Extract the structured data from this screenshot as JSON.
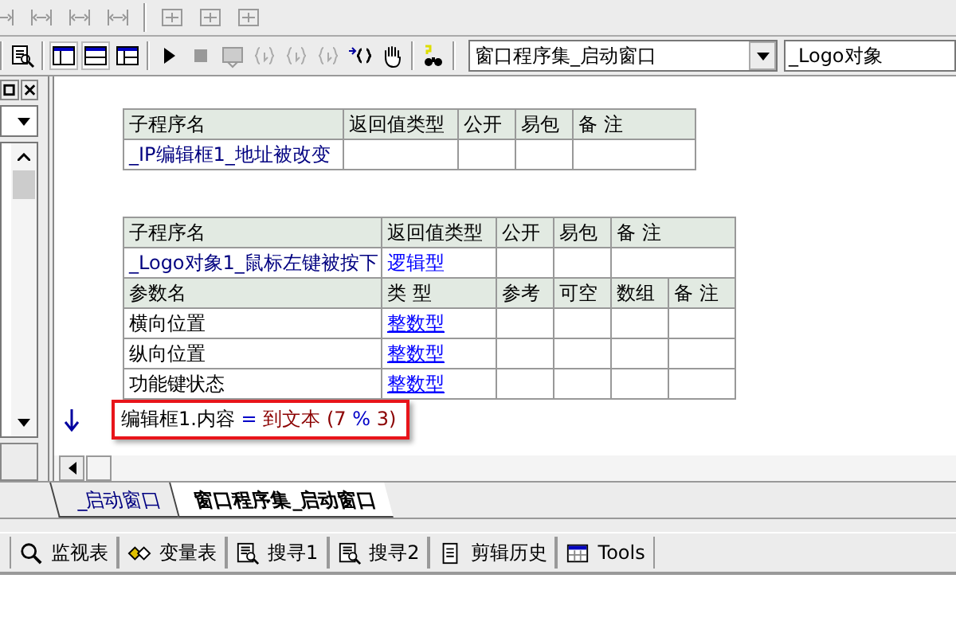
{
  "toolbar": {
    "module_select": {
      "value": "窗口程序集_启动窗口"
    },
    "object_select": {
      "value": "_Logo对象"
    }
  },
  "tables": [
    {
      "columns": [
        "子程序名",
        "返回值类型",
        "公开",
        "易包",
        "备 注"
      ],
      "row": {
        "name": "_IP编辑框1_地址被改变"
      }
    },
    {
      "columns": [
        "子程序名",
        "返回值类型",
        "公开",
        "易包",
        "备 注"
      ],
      "row": {
        "name": "_Logo对象1_鼠标左键被按下",
        "return_type": "逻辑型"
      },
      "param_columns": [
        "参数名",
        "类 型",
        "参考",
        "可空",
        "数组",
        "备 注"
      ],
      "params": [
        {
          "name": "横向位置",
          "type": "整数型"
        },
        {
          "name": "纵向位置",
          "type": "整数型"
        },
        {
          "name": "功能键状态",
          "type": "整数型"
        }
      ]
    }
  ],
  "code_line": {
    "highlighted": true,
    "tokens": [
      {
        "kind": "identifier",
        "text": "编辑框1.内容"
      },
      {
        "kind": "operator",
        "text": "="
      },
      {
        "kind": "function",
        "text": "到文本"
      },
      {
        "kind": "literal",
        "text": "(7"
      },
      {
        "kind": "operator",
        "text": "%"
      },
      {
        "kind": "literal",
        "text": "3)"
      }
    ]
  },
  "editor_tabs": [
    {
      "label": "_启动窗口",
      "selected": false
    },
    {
      "label": "窗口程序集_启动窗口",
      "selected": true
    }
  ],
  "panel_tabs": [
    {
      "label": "监视表",
      "kind": "watch"
    },
    {
      "label": "变量表",
      "kind": "variables"
    },
    {
      "label": "搜寻1",
      "kind": "search"
    },
    {
      "label": "搜寻2",
      "kind": "search"
    },
    {
      "label": "剪辑历史",
      "kind": "history"
    },
    {
      "label": "Tools",
      "kind": "tools"
    }
  ]
}
